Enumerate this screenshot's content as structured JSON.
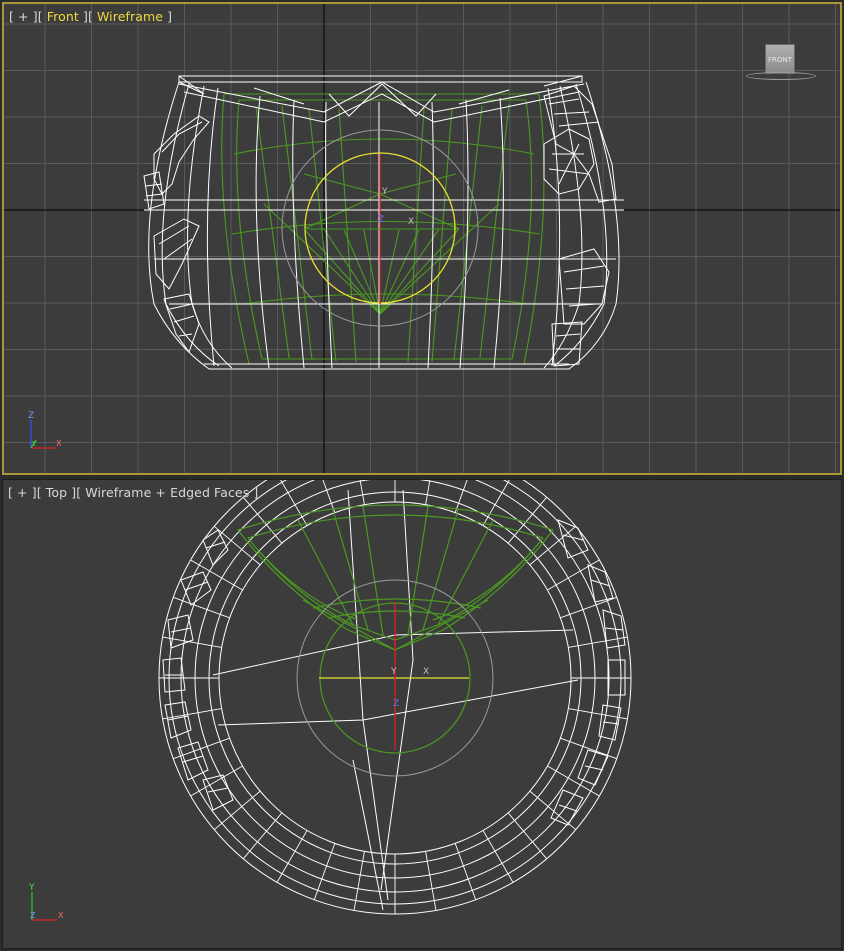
{
  "viewports": {
    "front": {
      "bracket_plus": "[ + ]",
      "bracket_open": "[",
      "view_name": "Front",
      "bracket_close": "]",
      "shading_open": "[",
      "shading_mode": "Wireframe",
      "shading_close": "]",
      "viewcube_label": "FRONT",
      "axes": {
        "up": "Z",
        "right": "X",
        "depth": "Y"
      },
      "gizmo_labels": {
        "y": "Y",
        "z": "Z",
        "x": "X"
      }
    },
    "top": {
      "bracket_plus": "[ + ]",
      "bracket_open": "[",
      "view_name": "Top",
      "bracket_close": "]",
      "shading_open": "[",
      "shading_mode": "Wireframe + Edged Faces",
      "shading_close": "]",
      "axes": {
        "up": "Y",
        "right": "X",
        "depth": "Z"
      },
      "gizmo_labels": {
        "y": "Y",
        "z": "Z",
        "x": "X"
      }
    }
  },
  "colors": {
    "active_border": "#a8983a",
    "active_label": "#f0d840",
    "grid": "#5a5a5a",
    "wire": "#ffffff",
    "selected": "#55aa22",
    "gizmo_yellow": "#e8e030",
    "axis_x": "#dd2222",
    "axis_y": "#22cc22",
    "axis_z": "#3355ff"
  }
}
